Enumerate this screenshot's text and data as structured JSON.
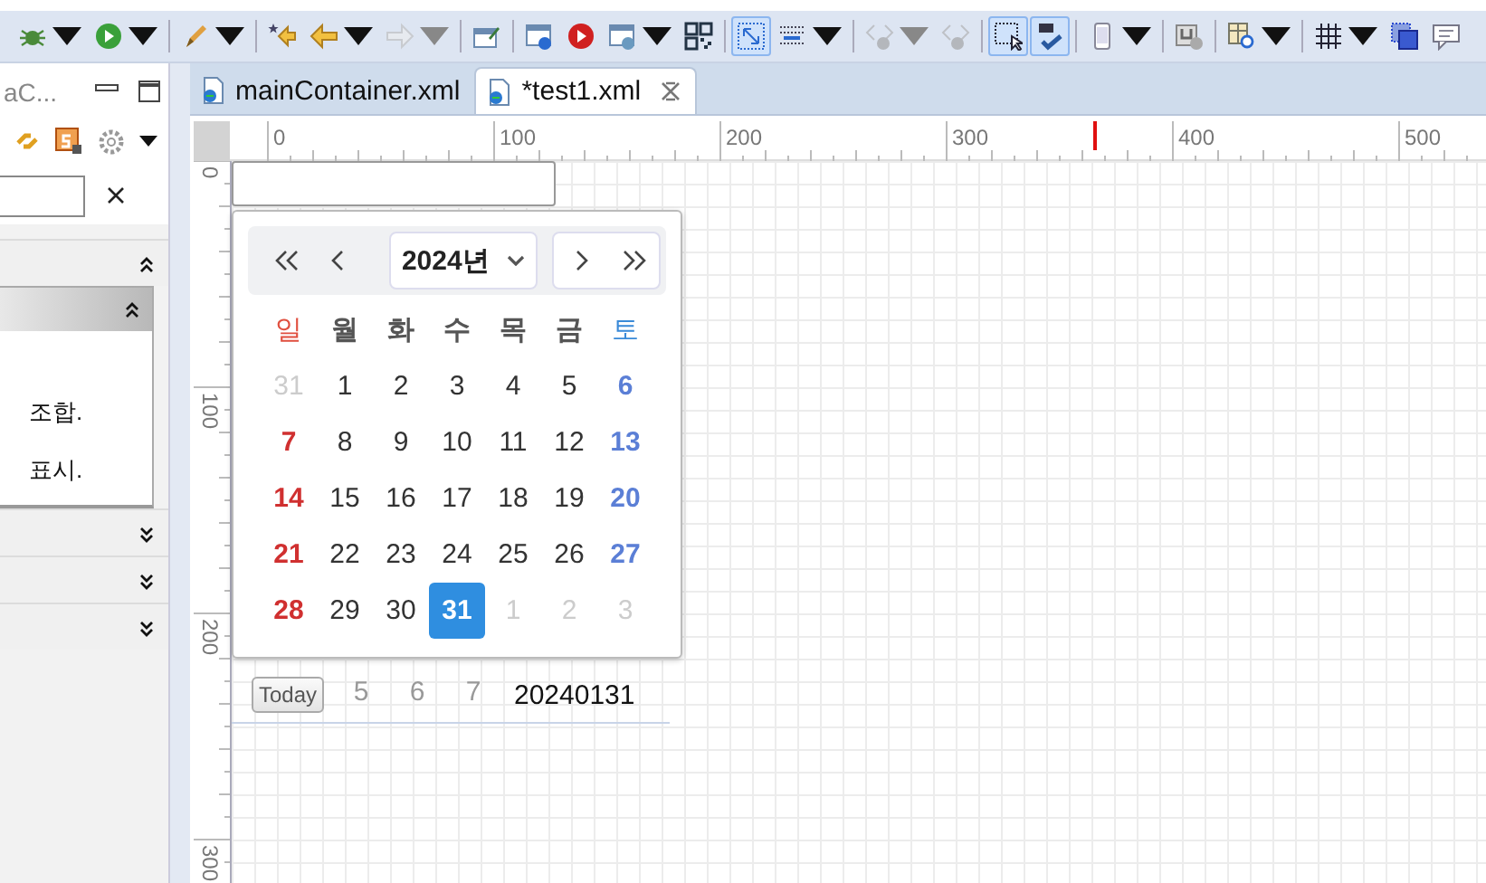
{
  "toolbar_groups": [
    [
      {
        "dropdown": true,
        "pressed": false,
        "disabled": false
      },
      {
        "dropdown": true,
        "pressed": false,
        "disabled": false
      }
    ],
    [
      {
        "dropdown": true,
        "pressed": false,
        "disabled": false
      }
    ],
    [
      {
        "dropdown": false,
        "pressed": false,
        "disabled": false
      },
      {
        "dropdown": true,
        "pressed": false,
        "disabled": false
      },
      {
        "dropdown": true,
        "pressed": false,
        "disabled": true
      }
    ],
    [
      {
        "dropdown": false,
        "pressed": false,
        "disabled": false
      }
    ],
    [
      {
        "dropdown": false,
        "pressed": false,
        "disabled": false
      },
      {
        "dropdown": false,
        "pressed": false,
        "disabled": false
      },
      {
        "dropdown": true,
        "pressed": false,
        "disabled": false
      },
      {
        "dropdown": false,
        "pressed": false,
        "disabled": false
      }
    ],
    [
      {
        "dropdown": false,
        "pressed": true,
        "disabled": false
      },
      {
        "dropdown": true,
        "pressed": false,
        "disabled": false
      }
    ],
    [
      {
        "dropdown": true,
        "pressed": false,
        "disabled": true
      },
      {
        "dropdown": false,
        "pressed": false,
        "disabled": true
      }
    ],
    [
      {
        "dropdown": false,
        "pressed": true,
        "disabled": false
      },
      {
        "dropdown": false,
        "pressed": true,
        "disabled": false
      }
    ],
    [
      {
        "dropdown": true,
        "pressed": false,
        "disabled": false
      }
    ],
    [
      {
        "dropdown": false,
        "pressed": false,
        "disabled": false
      }
    ],
    [
      {
        "dropdown": true,
        "pressed": false,
        "disabled": false
      }
    ],
    [
      {
        "dropdown": true,
        "pressed": false,
        "disabled": false
      },
      {
        "dropdown": false,
        "pressed": false,
        "disabled": false
      },
      {
        "dropdown": false,
        "pressed": false,
        "disabled": false
      }
    ]
  ],
  "side_panel": {
    "tab_label": "aC...",
    "sections": [
      {
        "expanded": true,
        "children": [
          {
            "expanded": true,
            "lines": [
              "조합.",
              "표시."
            ]
          }
        ]
      },
      {
        "expanded": false
      },
      {
        "expanded": false
      },
      {
        "expanded": false
      }
    ]
  },
  "editor_tabs": [
    {
      "label": "mainContainer.xml",
      "selected": false
    },
    {
      "label": "*test1.xml",
      "selected": true
    }
  ],
  "rulers": {
    "horizontal": [
      "0",
      "100",
      "200",
      "300",
      "400",
      "500"
    ],
    "vertical": [
      "0",
      "100",
      "200",
      "300"
    ]
  },
  "calendar": {
    "year": "2024년",
    "weekdays": [
      {
        "label": "일",
        "kind": "sunday"
      },
      {
        "label": "월",
        "kind": "weekday"
      },
      {
        "label": "화",
        "kind": "weekday"
      },
      {
        "label": "수",
        "kind": "weekday"
      },
      {
        "label": "목",
        "kind": "weekday"
      },
      {
        "label": "금",
        "kind": "weekday"
      },
      {
        "label": "토",
        "kind": "saturday"
      }
    ],
    "days": [
      {
        "day": "31",
        "kind": "other",
        "selected": false
      },
      {
        "day": "1",
        "kind": "weekday",
        "selected": false
      },
      {
        "day": "2",
        "kind": "weekday",
        "selected": false
      },
      {
        "day": "3",
        "kind": "weekday",
        "selected": false
      },
      {
        "day": "4",
        "kind": "weekday",
        "selected": false
      },
      {
        "day": "5",
        "kind": "weekday",
        "selected": false
      },
      {
        "day": "6",
        "kind": "saturday",
        "selected": false
      },
      {
        "day": "7",
        "kind": "sunday",
        "selected": false
      },
      {
        "day": "8",
        "kind": "weekday",
        "selected": false
      },
      {
        "day": "9",
        "kind": "weekday",
        "selected": false
      },
      {
        "day": "10",
        "kind": "weekday",
        "selected": false
      },
      {
        "day": "11",
        "kind": "weekday",
        "selected": false
      },
      {
        "day": "12",
        "kind": "weekday",
        "selected": false
      },
      {
        "day": "13",
        "kind": "saturday",
        "selected": false
      },
      {
        "day": "14",
        "kind": "sunday",
        "selected": false
      },
      {
        "day": "15",
        "kind": "weekday",
        "selected": false
      },
      {
        "day": "16",
        "kind": "weekday",
        "selected": false
      },
      {
        "day": "17",
        "kind": "weekday",
        "selected": false
      },
      {
        "day": "18",
        "kind": "weekday",
        "selected": false
      },
      {
        "day": "19",
        "kind": "weekday",
        "selected": false
      },
      {
        "day": "20",
        "kind": "saturday",
        "selected": false
      },
      {
        "day": "21",
        "kind": "sunday",
        "selected": false
      },
      {
        "day": "22",
        "kind": "weekday",
        "selected": false
      },
      {
        "day": "23",
        "kind": "weekday",
        "selected": false
      },
      {
        "day": "24",
        "kind": "weekday",
        "selected": false
      },
      {
        "day": "25",
        "kind": "weekday",
        "selected": false
      },
      {
        "day": "26",
        "kind": "weekday",
        "selected": false
      },
      {
        "day": "27",
        "kind": "saturday",
        "selected": false
      },
      {
        "day": "28",
        "kind": "sunday",
        "selected": false
      },
      {
        "day": "29",
        "kind": "weekday",
        "selected": false
      },
      {
        "day": "30",
        "kind": "weekday",
        "selected": false
      },
      {
        "day": "31",
        "kind": "weekday",
        "selected": true
      },
      {
        "day": "1",
        "kind": "other",
        "selected": false
      },
      {
        "day": "2",
        "kind": "other",
        "selected": false
      },
      {
        "day": "3",
        "kind": "other",
        "selected": false
      }
    ],
    "behind_days": [
      "5",
      "6",
      "7"
    ],
    "today_button": "Today",
    "value": "20240131"
  }
}
